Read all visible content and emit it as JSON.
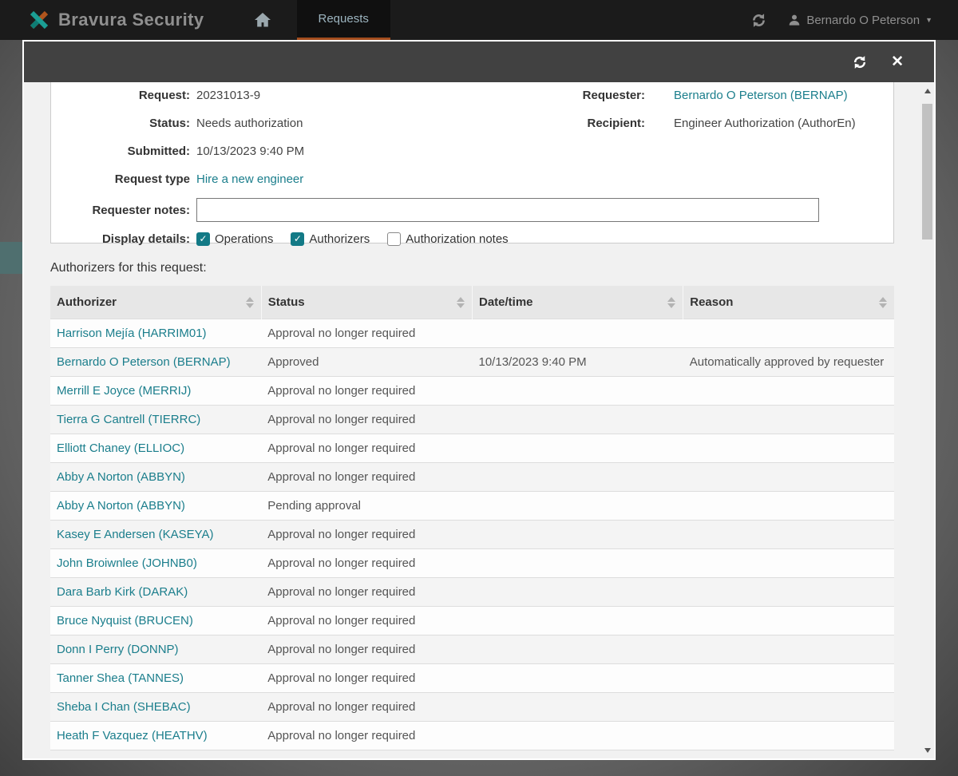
{
  "navbar": {
    "brand": "Bravura Security",
    "tab_requests": "Requests",
    "user_name": "Bernardo O Peterson"
  },
  "icons": {
    "close": "✕",
    "caret_down": "▼"
  },
  "modal": {
    "details": {
      "request_label": "Request:",
      "request_value": "20231013-9",
      "status_label": "Status:",
      "status_value": "Needs authorization",
      "submitted_label": "Submitted:",
      "submitted_value": "10/13/2023 9:40 PM",
      "request_type_label": "Request type",
      "request_type_value": "Hire a new engineer",
      "requester_label": "Requester:",
      "requester_value": "Bernardo O Peterson (BERNAP)",
      "recipient_label": "Recipient:",
      "recipient_value": "Engineer Authorization (AuthorEn)",
      "requester_notes_label": "Requester notes:",
      "requester_notes_value": "",
      "display_details_label": "Display details:",
      "checkboxes": [
        {
          "label": "Operations",
          "checked": true
        },
        {
          "label": "Authorizers",
          "checked": true
        },
        {
          "label": "Authorization notes",
          "checked": false
        }
      ]
    },
    "table": {
      "title": "Authorizers for this request:",
      "columns": [
        "Authorizer",
        "Status",
        "Date/time",
        "Reason"
      ],
      "rows": [
        {
          "authorizer": "Harrison Mejía (HARRIM01)",
          "status": "Approval no longer required",
          "datetime": "",
          "reason": ""
        },
        {
          "authorizer": "Bernardo O Peterson (BERNAP)",
          "status": "Approved",
          "datetime": "10/13/2023 9:40 PM",
          "reason": "Automatically approved by requester"
        },
        {
          "authorizer": "Merrill E Joyce (MERRIJ)",
          "status": "Approval no longer required",
          "datetime": "",
          "reason": ""
        },
        {
          "authorizer": "Tierra G Cantrell (TIERRC)",
          "status": "Approval no longer required",
          "datetime": "",
          "reason": ""
        },
        {
          "authorizer": "Elliott Chaney (ELLIOC)",
          "status": "Approval no longer required",
          "datetime": "",
          "reason": ""
        },
        {
          "authorizer": "Abby A Norton (ABBYN)",
          "status": "Approval no longer required",
          "datetime": "",
          "reason": ""
        },
        {
          "authorizer": "Abby A Norton (ABBYN)",
          "status": "Pending approval",
          "datetime": "",
          "reason": ""
        },
        {
          "authorizer": "Kasey E Andersen (KASEYA)",
          "status": "Approval no longer required",
          "datetime": "",
          "reason": ""
        },
        {
          "authorizer": "John Broiwnlee (JOHNB0)",
          "status": "Approval no longer required",
          "datetime": "",
          "reason": ""
        },
        {
          "authorizer": "Dara Barb Kirk (DARAK)",
          "status": "Approval no longer required",
          "datetime": "",
          "reason": ""
        },
        {
          "authorizer": "Bruce Nyquist (BRUCEN)",
          "status": "Approval no longer required",
          "datetime": "",
          "reason": ""
        },
        {
          "authorizer": "Donn I Perry (DONNP)",
          "status": "Approval no longer required",
          "datetime": "",
          "reason": ""
        },
        {
          "authorizer": "Tanner Shea (TANNES)",
          "status": "Approval no longer required",
          "datetime": "",
          "reason": ""
        },
        {
          "authorizer": "Sheba I Chan (SHEBAC)",
          "status": "Approval no longer required",
          "datetime": "",
          "reason": ""
        },
        {
          "authorizer": "Heath F Vazquez (HEATHV)",
          "status": "Approval no longer required",
          "datetime": "",
          "reason": ""
        }
      ]
    }
  },
  "colors": {
    "accent_teal": "#137a86",
    "link_teal": "#1b7e8c",
    "tab_underline_orange": "#a34d1e",
    "navbar_bg": "#1b1b1b",
    "modal_header_bg": "#414141"
  }
}
